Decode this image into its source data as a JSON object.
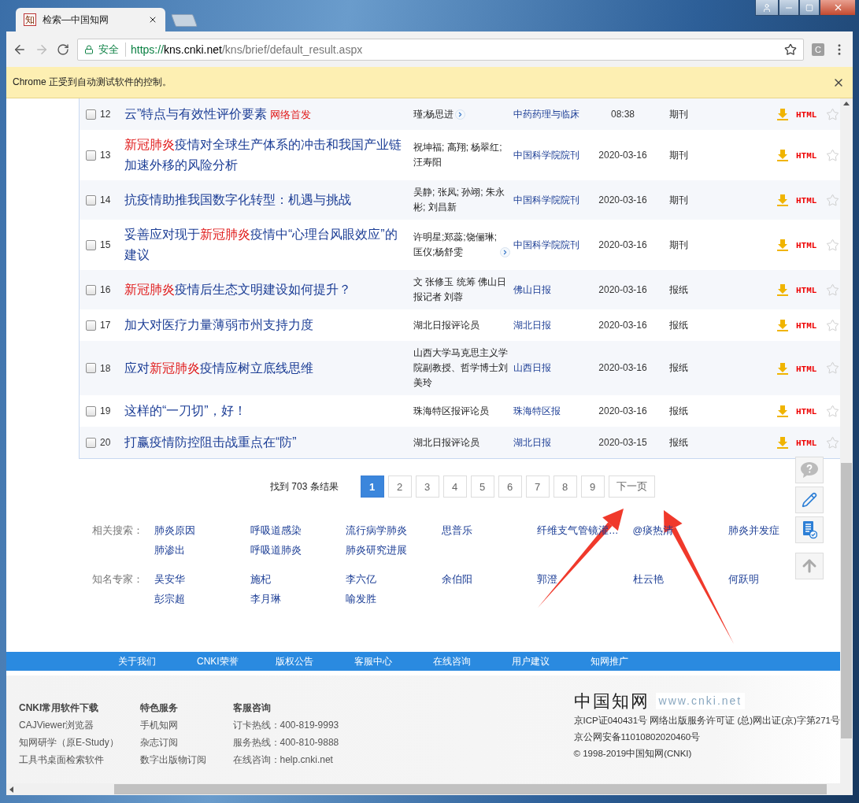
{
  "window": {
    "tab_icon": "知",
    "tab_title": "检索—中国知网"
  },
  "toolbar": {
    "security_label": "安全",
    "url_scheme": "https://",
    "url_host": "kns.cnki.net",
    "url_path": "/kns/brief/default_result.aspx",
    "extension_label": "C"
  },
  "infobar": {
    "message": "Chrome 正受到自动测试软件的控制。"
  },
  "results": [
    {
      "number": "12",
      "checked": false,
      "title_parts": [
        {
          "text": "云”特点与有效性评价要素",
          "hit": false
        }
      ],
      "badge": "网络首发",
      "authors": "瑾;杨思进",
      "authors_more": true,
      "source": "中药药理与临床",
      "time": "08:38",
      "type": "期刊",
      "format": "HTML"
    },
    {
      "number": "13",
      "checked": false,
      "title_parts": [
        {
          "text": "新冠肺炎",
          "hit": true
        },
        {
          "text": "疫情对全球生产体系的冲击和我国产业链加速外移的风险分析",
          "hit": false
        }
      ],
      "authors": "祝坤福; 高翔; 杨翠红; 汪寿阳",
      "authors_more": false,
      "source": "中国科学院院刊",
      "date": "2020-03-16",
      "type": "期刊",
      "format": "HTML"
    },
    {
      "number": "14",
      "checked": false,
      "title_parts": [
        {
          "text": "抗疫情助推我国数字化转型：机遇与挑战",
          "hit": false
        }
      ],
      "authors": "吴静; 张凤; 孙翊; 朱永彬; 刘昌新",
      "authors_more": false,
      "source": "中国科学院院刊",
      "date": "2020-03-16",
      "type": "期刊",
      "format": "HTML"
    },
    {
      "number": "15",
      "checked": false,
      "title_parts": [
        {
          "text": "妥善应对现于",
          "hit": false
        },
        {
          "text": "新冠肺炎",
          "hit": true
        },
        {
          "text": "疫情中“心理台风眼效应”的建议",
          "hit": false
        }
      ],
      "authors": "许明星;郑蕊;饶俪琳;匡仪;杨舒雯",
      "authors_more": true,
      "source": "中国科学院院刊",
      "date": "2020-03-16",
      "type": "期刊",
      "format": "HTML"
    },
    {
      "number": "16",
      "checked": false,
      "title_parts": [
        {
          "text": "新冠肺炎",
          "hit": true
        },
        {
          "text": "疫情后生态文明建设如何提升？",
          "hit": false
        }
      ],
      "authors": "文 张修玉 统筹 佛山日报记者 刘蓉",
      "authors_more": false,
      "source": "佛山日报",
      "date": "2020-03-16",
      "type": "报纸",
      "format": "HTML"
    },
    {
      "number": "17",
      "checked": false,
      "title_parts": [
        {
          "text": "加大对医疗力量薄弱市州支持力度",
          "hit": false
        }
      ],
      "authors": "湖北日报评论员",
      "authors_more": false,
      "source": "湖北日报",
      "date": "2020-03-16",
      "type": "报纸",
      "format": "HTML"
    },
    {
      "number": "18",
      "checked": false,
      "title_parts": [
        {
          "text": "应对",
          "hit": false
        },
        {
          "text": "新冠肺炎",
          "hit": true
        },
        {
          "text": "疫情应树立底线思维",
          "hit": false
        }
      ],
      "authors": "山西大学马克思主义学院副教授、哲学博士刘美玲",
      "authors_more": false,
      "source": "山西日报",
      "date": "2020-03-16",
      "type": "报纸",
      "format": "HTML"
    },
    {
      "number": "19",
      "checked": false,
      "title_parts": [
        {
          "text": "这样的“一刀切”，好！",
          "hit": false
        }
      ],
      "authors": "珠海特区报评论员",
      "authors_more": false,
      "source": "珠海特区报",
      "date": "2020-03-16",
      "type": "报纸",
      "format": "HTML"
    },
    {
      "number": "20",
      "checked": false,
      "title_parts": [
        {
          "text": "打赢疫情防控阻击战重点在“防”",
          "hit": false
        }
      ],
      "authors": "湖北日报评论员",
      "authors_more": false,
      "source": "湖北日报",
      "date": "2020-03-15",
      "type": "报纸",
      "format": "HTML"
    }
  ],
  "pagination": {
    "summary": "找到 703 条结果",
    "pages": [
      {
        "label": "1",
        "selected": true
      },
      {
        "label": "2",
        "selected": false
      },
      {
        "label": "3",
        "selected": false
      },
      {
        "label": "4",
        "selected": false
      },
      {
        "label": "5",
        "selected": false
      },
      {
        "label": "6",
        "selected": false
      },
      {
        "label": "7",
        "selected": false
      },
      {
        "label": "8",
        "selected": false
      },
      {
        "label": "9",
        "selected": false
      }
    ],
    "next": "下一页"
  },
  "related_searches": {
    "label": "相关搜索：",
    "items": [
      "肺炎原因",
      "呼吸道感染",
      "流行病学肺炎",
      "思普乐",
      "纤维支气管镜灌…",
      "@痰热清",
      "肺炎并发症",
      "肺渗出",
      "呼吸道肺炎",
      "肺炎研究进展"
    ]
  },
  "experts": {
    "label": "知名专家：",
    "items": [
      "吴安华",
      "施杞",
      "李六亿",
      "余伯阳",
      "郭澄",
      "杜云艳",
      "何跃明",
      "彭宗超",
      "李月琳",
      "喻发胜"
    ]
  },
  "footer_nav": [
    "关于我们",
    "CNKI荣誉",
    "版权公告",
    "客服中心",
    "在线咨询",
    "用户建议",
    "知网推广"
  ],
  "footer_columns": [
    {
      "heading": "CNKI常用软件下载",
      "items": [
        "CAJViewer浏览器",
        "知网研学（原E-Study）",
        "工具书桌面检索软件"
      ]
    },
    {
      "heading": "特色服务",
      "items": [
        "手机知网",
        "杂志订阅",
        "数字出版物订阅"
      ]
    },
    {
      "heading": "客服咨询",
      "items": [
        "订卡热线：400-819-9993",
        "服务热线：400-810-9888",
        "在线咨询：help.cnki.net"
      ]
    }
  ],
  "footer_brand": {
    "logo": "中国知网",
    "site": "www.cnki.net",
    "lines": [
      "京ICP证040431号 网络出版服务许可证 (总)网出证(京)字第271号",
      "京公网安备11010802020460号",
      "© 1998-2019中国知网(CNKI)"
    ]
  }
}
